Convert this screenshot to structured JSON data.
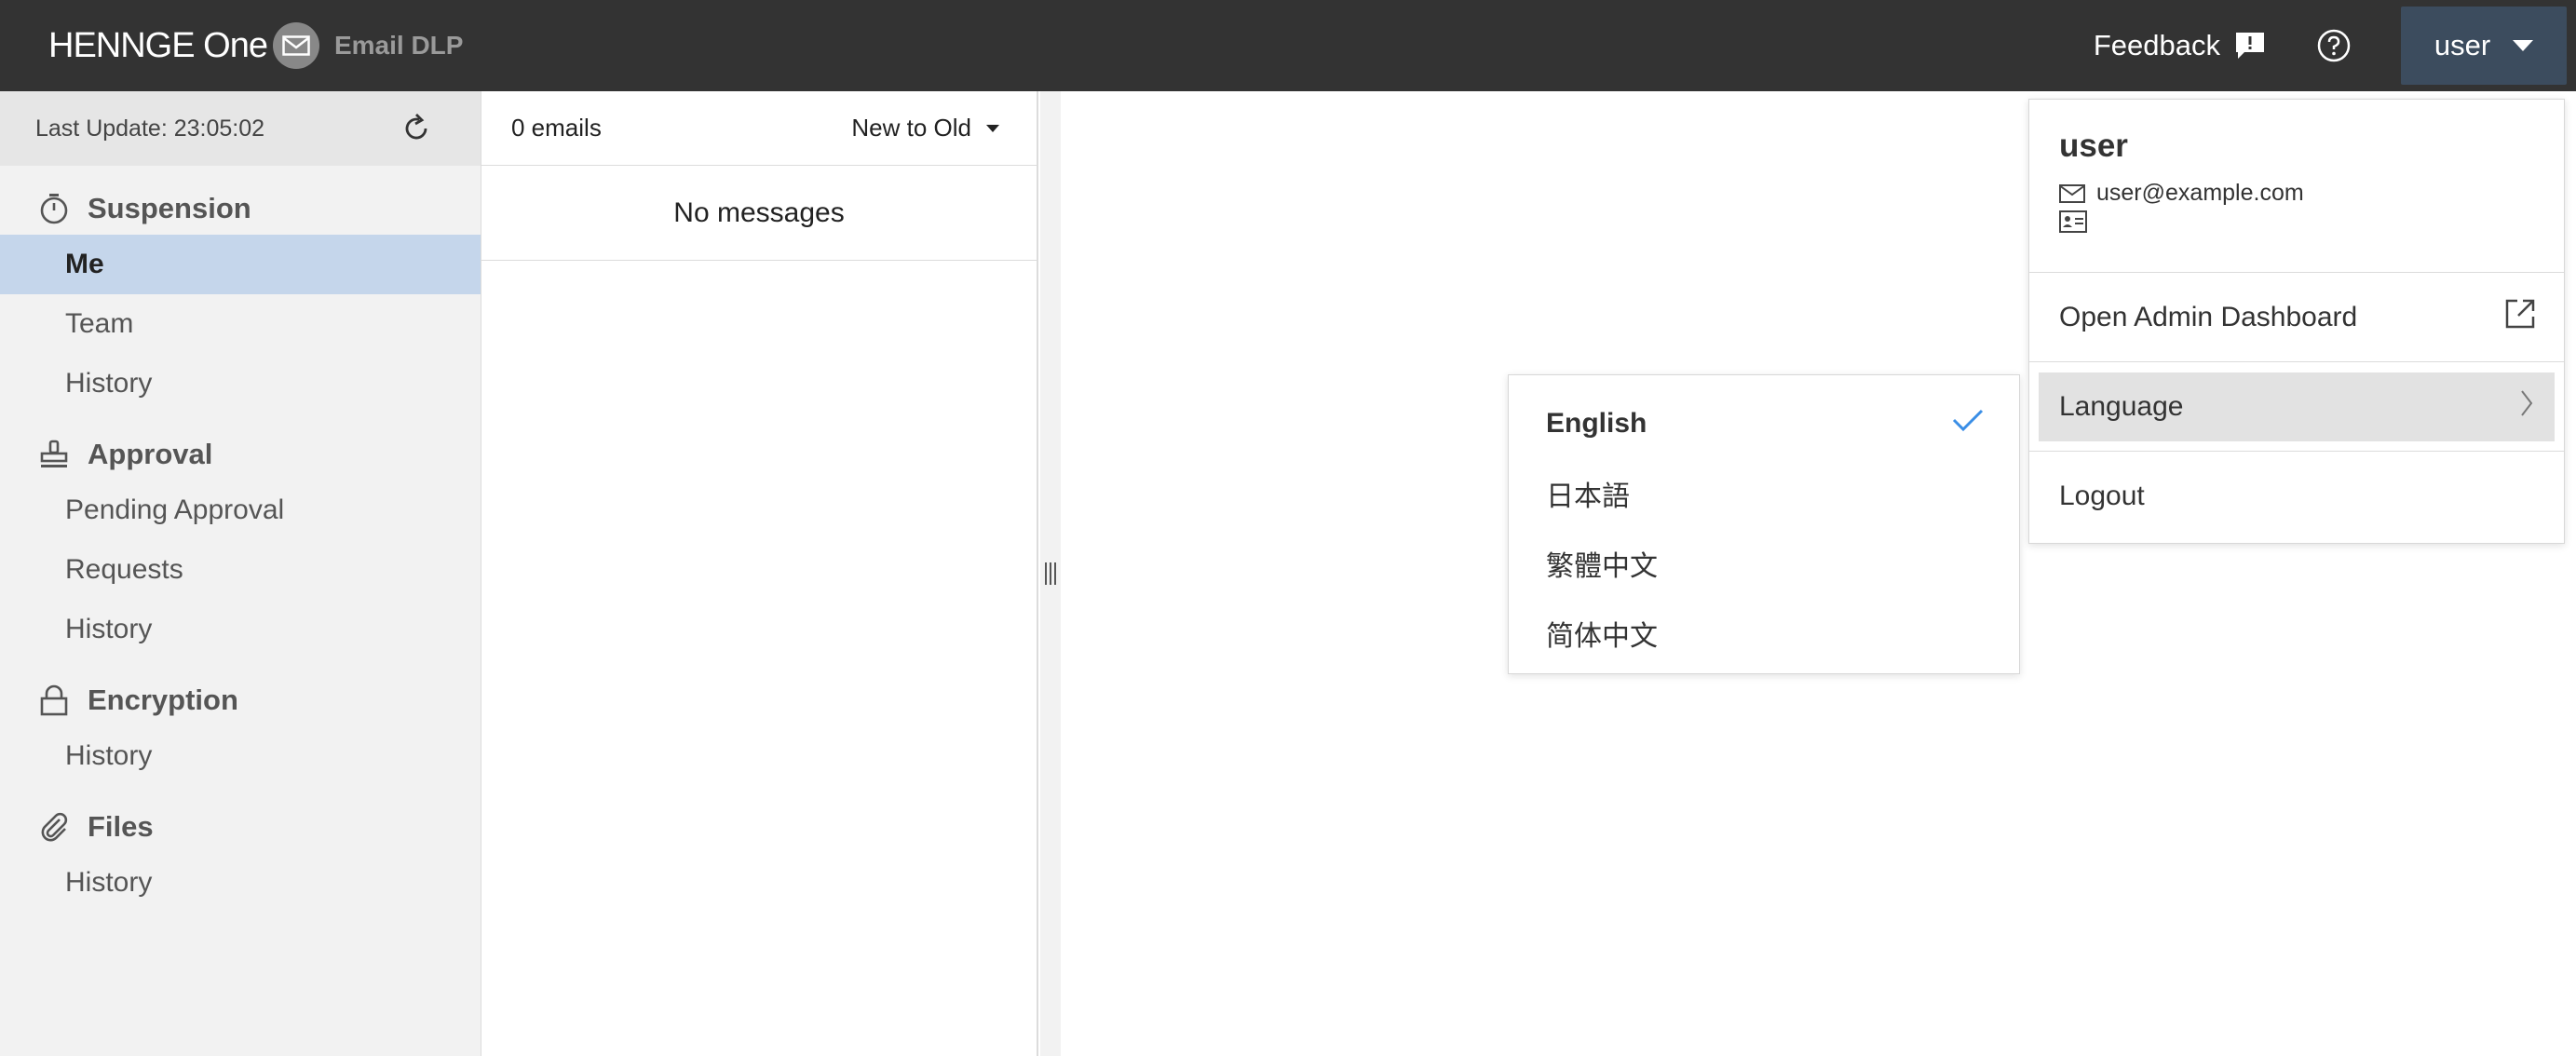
{
  "header": {
    "brand": "HENNGE One",
    "product": "Email DLP",
    "feedback_label": "Feedback",
    "user_button_label": "user"
  },
  "sidebar": {
    "last_update": "Last Update: 23:05:02",
    "sections": [
      {
        "title": "Suspension",
        "icon": "stopwatch-icon",
        "items": [
          "Me",
          "Team",
          "History"
        ]
      },
      {
        "title": "Approval",
        "icon": "stamp-icon",
        "items": [
          "Pending Approval",
          "Requests",
          "History"
        ]
      },
      {
        "title": "Encryption",
        "icon": "lock-icon",
        "items": [
          "History"
        ]
      },
      {
        "title": "Files",
        "icon": "paperclip-icon",
        "items": [
          "History"
        ]
      }
    ],
    "active_item": "Me"
  },
  "mail_list": {
    "count": "0 emails",
    "sort_label": "New to Old",
    "empty_text": "No messages"
  },
  "user_menu": {
    "name": "user",
    "email": "user@example.com",
    "open_admin_label": "Open Admin Dashboard",
    "language_label": "Language",
    "logout_label": "Logout"
  },
  "language_menu": {
    "options": [
      "English",
      "日本語",
      "繁體中文",
      "简体中文"
    ],
    "selected": "English"
  },
  "colors": {
    "header_bg": "#333333",
    "user_button_bg": "#3c4c5e",
    "active_nav_bg": "#c5d6eb",
    "check_color": "#3a8ee6"
  }
}
